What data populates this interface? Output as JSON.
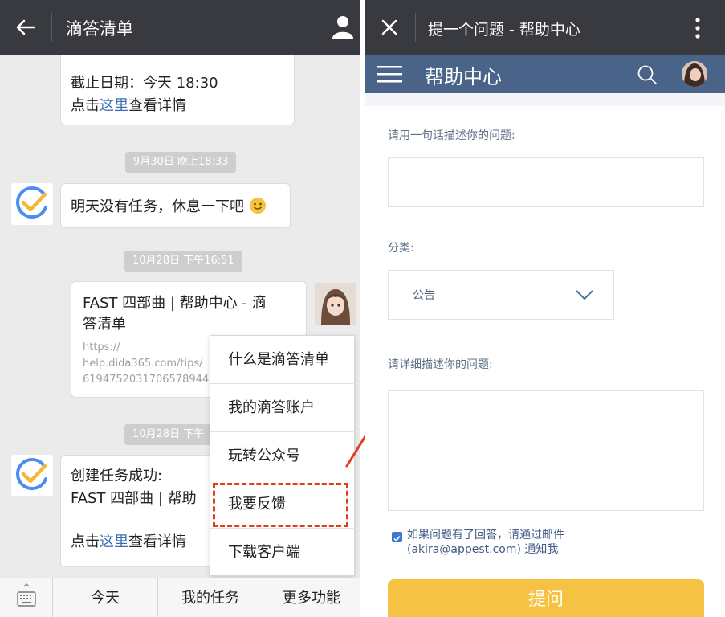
{
  "left": {
    "header": {
      "title": "滴答清单"
    },
    "bubble1": {
      "line1": "截止日期：今天 18:30",
      "line2_prefix": "点击",
      "line2_link": "这里",
      "line2_suffix": "查看详情"
    },
    "timestamp1": "9月30日 晚上18:33",
    "bubble2": {
      "text": "明天没有任务，休息一下吧"
    },
    "timestamp2": "10月28日 下午16:51",
    "bubble3": {
      "title_line1": "FAST 四部曲 | 帮助中心 - 滴",
      "title_line2": "答清单",
      "url_line1": "https://",
      "url_line2": "help.dida365.com/tips/",
      "url_line3": "6194752031706578944"
    },
    "timestamp3": "10月28日 下午",
    "bubble4": {
      "line1": "创建任务成功:",
      "line2": "FAST 四部曲 | 帮助",
      "line3_prefix": "点击",
      "line3_link": "这里",
      "line3_suffix": "查看详情"
    },
    "menu": {
      "items": [
        {
          "label": "什么是滴答清单"
        },
        {
          "label": "我的滴答账户"
        },
        {
          "label": "玩转公众号"
        },
        {
          "label": "我要反馈"
        },
        {
          "label": "下载客户端"
        }
      ]
    },
    "bottom_tabs": [
      {
        "label": "今天"
      },
      {
        "label": "我的任务"
      },
      {
        "label": "更多功能"
      }
    ],
    "colors": {
      "header": "#393a3f",
      "highlight": "#e03c1e",
      "link": "#3b6fb3"
    }
  },
  "right": {
    "header": {
      "title": "提一个问题 - 帮助中心"
    },
    "help_bar": {
      "title": "帮助中心"
    },
    "form": {
      "summary_label": "请用一句话描述你的问题:",
      "summary_value": "",
      "category_label": "分类:",
      "category_value": "公告",
      "detail_label": "请详细描述你的问题:",
      "detail_value": "",
      "notify_checked": true,
      "notify_line1": "如果问题有了回答，请通过邮件",
      "notify_line2": "(akira@appest.com) 通知我",
      "submit_label": "提问"
    },
    "colors": {
      "help_bar": "#4a6489",
      "submit": "#f6c243",
      "checkbox": "#3b79d3"
    }
  }
}
